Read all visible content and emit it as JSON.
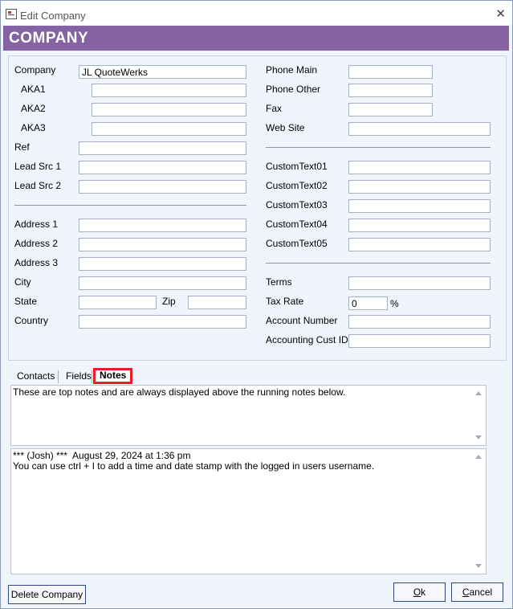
{
  "window": {
    "title": "Edit Company",
    "close_glyph": "✕"
  },
  "banner": {
    "title": "COMPANY"
  },
  "left": {
    "company": {
      "label": "Company",
      "value": "JL QuoteWerks"
    },
    "aka1": {
      "label": "AKA1",
      "value": ""
    },
    "aka2": {
      "label": "AKA2",
      "value": ""
    },
    "aka3": {
      "label": "AKA3",
      "value": ""
    },
    "ref": {
      "label": "Ref",
      "value": ""
    },
    "lead1": {
      "label": "Lead Src 1",
      "value": ""
    },
    "lead2": {
      "label": "Lead Src 2",
      "value": ""
    },
    "addr1": {
      "label": "Address 1",
      "value": ""
    },
    "addr2": {
      "label": "Address 2",
      "value": ""
    },
    "addr3": {
      "label": "Address 3",
      "value": ""
    },
    "city": {
      "label": "City",
      "value": ""
    },
    "state": {
      "label": "State",
      "value": ""
    },
    "zip": {
      "label": "Zip",
      "value": ""
    },
    "country": {
      "label": "Country",
      "value": ""
    }
  },
  "right": {
    "phone_main": {
      "label": "Phone Main",
      "value": ""
    },
    "phone_other": {
      "label": "Phone Other",
      "value": ""
    },
    "fax": {
      "label": "Fax",
      "value": ""
    },
    "website": {
      "label": "Web Site",
      "value": ""
    },
    "ct1": {
      "label": "CustomText01",
      "value": ""
    },
    "ct2": {
      "label": "CustomText02",
      "value": ""
    },
    "ct3": {
      "label": "CustomText03",
      "value": ""
    },
    "ct4": {
      "label": "CustomText04",
      "value": ""
    },
    "ct5": {
      "label": "CustomText05",
      "value": ""
    },
    "terms": {
      "label": "Terms",
      "value": ""
    },
    "tax": {
      "label": "Tax Rate",
      "value": "0",
      "unit": "%"
    },
    "acct_num": {
      "label": "Account Number",
      "value": ""
    },
    "acct_cust": {
      "label": "Accounting Cust ID",
      "value": ""
    }
  },
  "tabs": {
    "contacts": "Contacts",
    "fields": "Fields",
    "notes": "Notes"
  },
  "notes": {
    "top": "These are top notes and are always displayed above the running notes below.",
    "running": "*** (Josh) ***  August 29, 2024 at 1:36 pm\nYou can use ctrl + I to add a time and date stamp with the logged in users username."
  },
  "buttons": {
    "delete": "Delete Company",
    "ok_key": "O",
    "ok_rest": "k",
    "cancel_key": "C",
    "cancel_rest": "ancel"
  }
}
